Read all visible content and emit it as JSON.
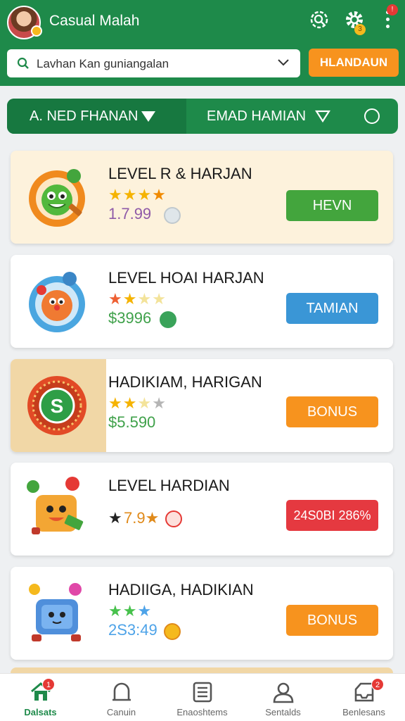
{
  "header": {
    "user_name": "Casual Malah",
    "settings_badge": "3",
    "notification_badge": "!",
    "search_value": "Lavhan Kan guniangalan",
    "action_button": "HLANDAUN"
  },
  "tabs": [
    {
      "label": "A. NED FHANAN",
      "active": true
    },
    {
      "label": "EMAD HAMIAN",
      "active": false
    }
  ],
  "cards": [
    {
      "title": "LEVEL R & HARJAN",
      "stars": "★★★★",
      "price": "1.7.99",
      "action": "HEVN",
      "action_color": "#43a53d",
      "icon": "frog-mascot-icon"
    },
    {
      "title": "LEVEL HOAI HARJAN",
      "stars": "★★★★",
      "price": "$3996",
      "action": "TAMIAN",
      "action_color": "#3a96d6",
      "icon": "clown-mascot-icon"
    },
    {
      "title": "HADIKIAM, HARIGAN",
      "stars": "★★★★",
      "price": "$5.590",
      "action": "BONUS",
      "action_color": "#f7931e",
      "icon": "dollar-coin-icon"
    },
    {
      "title": "LEVEL HARDIAN",
      "stars": "★",
      "price": "7.9★",
      "action": "24S0BI 286%",
      "action_color": "#e53940",
      "icon": "box-mascot-icon"
    },
    {
      "title": "HADIIGA, HADIKIAN",
      "stars": "★★★",
      "price": "2S3:49",
      "action": "BONUS",
      "action_color": "#f7931e",
      "icon": "tv-mascot-icon"
    }
  ],
  "bottom_nav": [
    {
      "label": "Dalsats",
      "badge": "1",
      "icon": "home-icon",
      "active": true
    },
    {
      "label": "Canuin",
      "badge": "",
      "icon": "chat-icon",
      "active": false
    },
    {
      "label": "Enaoshtems",
      "badge": "",
      "icon": "list-icon",
      "active": false
    },
    {
      "label": "Sentalds",
      "badge": "",
      "icon": "profile-icon",
      "active": false
    },
    {
      "label": "Benlesans",
      "badge": "2",
      "icon": "inbox-icon",
      "active": false
    }
  ]
}
